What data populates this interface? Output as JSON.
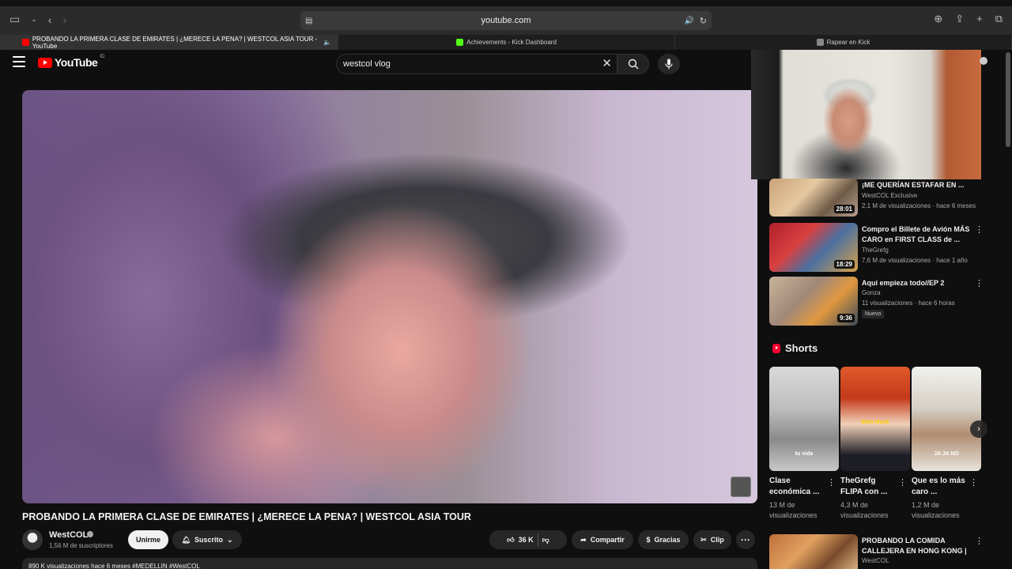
{
  "browser": {
    "url": "youtube.com",
    "tabs": [
      {
        "label": "PROBANDO LA PRIMERA CLASE DE EMIRATES | ¿MERECE LA PENA? | WESTCOL ASIA TOUR - YouTube",
        "color": "#ff0000"
      },
      {
        "label": "Achievements - Kick Dashboard",
        "color": "#53fc18"
      },
      {
        "label": "Rapear en Kick",
        "color": "#888888"
      }
    ]
  },
  "header": {
    "logo": "YouTube",
    "country": "ID",
    "search_value": "westcol vlog"
  },
  "video": {
    "title": "PROBANDO LA PRIMERA CLASE DE EMIRATES | ¿MERECE LA PENA? | WESTCOL ASIA TOUR",
    "channel": "WestCOL",
    "subscribers": "1,56 M de suscriptores",
    "join_label": "Unirme",
    "subscribe_label": "Suscrito",
    "likes": "36 K",
    "share_label": "Compartir",
    "thanks_label": "Gracias",
    "clip_label": "Clip",
    "more": "···",
    "description_preview": "890 K visualizaciones  hace 6 meses  #MEDELLIN #WestCOL"
  },
  "recommendations": [
    {
      "title": "¡ME QUERÍAN ESTAFAR EN ...",
      "channel": "WestCOL Exclusive",
      "meta": "2,1 M de visualizaciones · hace 6 meses",
      "duration": "28:01",
      "verified": false,
      "new": false
    },
    {
      "title": "Compro el Billete de Avión MÁS CARO en FIRST CLASS de ...",
      "channel": "TheGrefg",
      "meta": "7,6 M de visualizaciones · hace 1 año",
      "duration": "18:29",
      "verified": true,
      "new": false
    },
    {
      "title": "Aquí empieza todo//EP 2",
      "channel": "Gonza",
      "meta": "11 visualizaciones · hace 6 horas",
      "duration": "9:36",
      "verified": false,
      "new": true,
      "new_label": "Nuevo"
    },
    {
      "title": "PROBANDO LA COMIDA CALLEJERA EN HONG KONG | ...",
      "channel": "WestCOL",
      "meta": "",
      "duration": "",
      "verified": true,
      "new": false
    }
  ],
  "shorts": {
    "heading": "Shorts",
    "items": [
      {
        "title": "Clase económica ...",
        "views": "13 M de visualizaciones",
        "caption": "tu vida"
      },
      {
        "title": "TheGrefg FLIPA con ...",
        "views": "4,3 M de visualizaciones",
        "caption": "Elon Musk"
      },
      {
        "title": "Que es lo más caro ...",
        "views": "1,2 M de visualizaciones",
        "caption": "JA JA NO"
      }
    ]
  }
}
